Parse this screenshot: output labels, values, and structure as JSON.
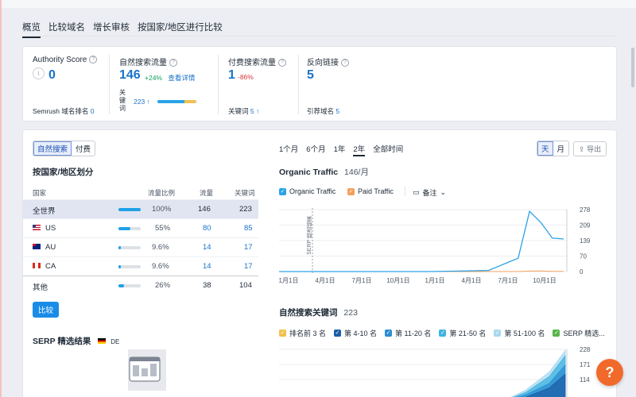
{
  "tabs": [
    {
      "label": "概览",
      "active": true
    },
    {
      "label": "比较域名"
    },
    {
      "label": "增长审核"
    },
    {
      "label": "按国家/地区进行比较"
    }
  ],
  "metrics": {
    "authority": {
      "label": "Authority Score",
      "value": "0",
      "sub_label": "Semrush 域名排名",
      "sub_value": "0"
    },
    "organic": {
      "label": "自然搜索流量",
      "value": "146",
      "change": "+24%",
      "link": "查看详情",
      "kw_label": "关键词",
      "kw_value": "223 ↑"
    },
    "paid": {
      "label": "付费搜索流量",
      "value": "1",
      "change": "-86%",
      "sub_label": "关键词",
      "sub_value": "5 ↑"
    },
    "backlinks": {
      "label": "反向链接",
      "value": "5",
      "sub_label": "引荐域名",
      "sub_value": "5"
    }
  },
  "left": {
    "toggle": [
      "自然搜索",
      "付费"
    ],
    "title": "按国家/地区划分",
    "headers": [
      "国家",
      "流量比例",
      "流量",
      "关键词"
    ],
    "rows": [
      {
        "name": "全世界",
        "share": "100%",
        "traffic": "146",
        "kw": "223",
        "pct": 100
      },
      {
        "name": "US",
        "share": "55%",
        "traffic": "80",
        "kw": "85",
        "pct": 55
      },
      {
        "name": "AU",
        "share": "9.6%",
        "traffic": "14",
        "kw": "17",
        "pct": 9.6
      },
      {
        "name": "CA",
        "share": "9.6%",
        "traffic": "14",
        "kw": "17",
        "pct": 9.6
      },
      {
        "name": "其他",
        "share": "26%",
        "traffic": "38",
        "kw": "104",
        "pct": 26
      }
    ],
    "compare_btn": "比较",
    "serp_title": "SERP 精选结果",
    "serp_db": "DE"
  },
  "right": {
    "periods": [
      "1个月",
      "6个月",
      "1年",
      "2年",
      "全部时间"
    ],
    "granularity": [
      "天",
      "月"
    ],
    "export": "导出",
    "traffic_title": "Organic Traffic",
    "traffic_value": "146/月",
    "legend_organic": "Organic Traffic",
    "legend_paid": "Paid Traffic",
    "notes": "备注",
    "serp_label": "SERP 精选结果",
    "x_ticks": [
      "1月1日",
      "4月1日",
      "7月1日",
      "10月1日",
      "1月1日",
      "4月1日",
      "7月1日",
      "10月1日"
    ],
    "y_ticks": [
      "278",
      "209",
      "139",
      "70",
      "0"
    ],
    "kw_title": "自然搜索关键词",
    "kw_value": "223",
    "kw_legend": [
      {
        "label": "排名前 3 名",
        "color": "#f2c14e"
      },
      {
        "label": "第 4-10 名",
        "color": "#1c5ea8"
      },
      {
        "label": "第 11-20 名",
        "color": "#2b8ed1"
      },
      {
        "label": "第 21-50 名",
        "color": "#3fb3e0"
      },
      {
        "label": "第 51-100 名",
        "color": "#a7d8f0"
      },
      {
        "label": "SERP 精选...",
        "color": "#5ab54a"
      }
    ],
    "kw_y_ticks": [
      "228",
      "171",
      "114"
    ]
  },
  "help": "?",
  "colors": {
    "accent": "#1a73c9",
    "organic": "#2aa3e6",
    "paid": "#f3a05c",
    "help": "#f26a2b"
  },
  "chart_data": [
    {
      "type": "line",
      "title": "Organic Traffic",
      "x": [
        "1月1日",
        "4月1日",
        "7月1日",
        "10月1日",
        "1月1日",
        "4月1日",
        "7月1日",
        "10月1日"
      ],
      "series": [
        {
          "name": "Organic Traffic",
          "values": [
            0,
            0,
            0,
            0,
            0,
            2,
            5,
            60,
            270,
            220,
            150,
            146
          ]
        },
        {
          "name": "Paid Traffic",
          "values": [
            0,
            0,
            0,
            0,
            0,
            0,
            0,
            0,
            2,
            3,
            1,
            1
          ]
        }
      ],
      "ylim": [
        0,
        278
      ]
    },
    {
      "type": "area",
      "title": "自然搜索关键词",
      "series": [
        {
          "name": "排名前 3 名",
          "values": [
            0,
            2,
            4,
            5
          ]
        },
        {
          "name": "第 4-10 名",
          "values": [
            0,
            20,
            60,
            120
          ]
        },
        {
          "name": "第 11-20 名",
          "values": [
            0,
            30,
            80,
            160
          ]
        },
        {
          "name": "第 21-50 名",
          "values": [
            0,
            40,
            110,
            200
          ]
        },
        {
          "name": "第 51-100 名",
          "values": [
            0,
            50,
            130,
            223
          ]
        }
      ],
      "ylim": [
        0,
        228
      ]
    }
  ]
}
